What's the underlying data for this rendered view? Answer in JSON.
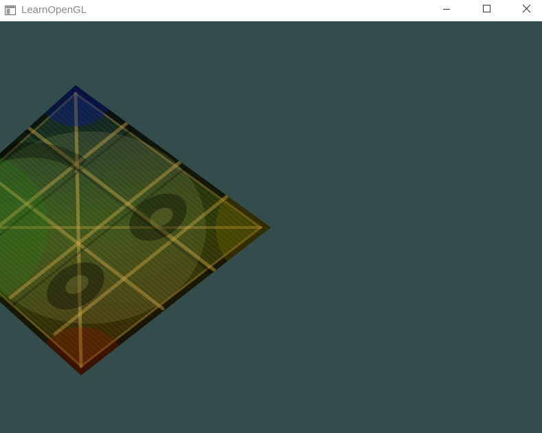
{
  "window": {
    "title": "LearnOpenGL",
    "controls": {
      "minimize_icon": "minimize-icon",
      "maximize_icon": "maximize-icon",
      "close_icon": "close-icon"
    }
  },
  "viewport": {
    "clear_color": "#334d4d",
    "object": {
      "description_icon": "textured-quad",
      "texture_main": "wooden-container",
      "texture_overlay": "awesomeface-smiley",
      "vertex_colors": {
        "top": "#0000ff",
        "left": "#00ff00",
        "right": "#ffff00",
        "bottom": "#ff0000"
      }
    }
  }
}
